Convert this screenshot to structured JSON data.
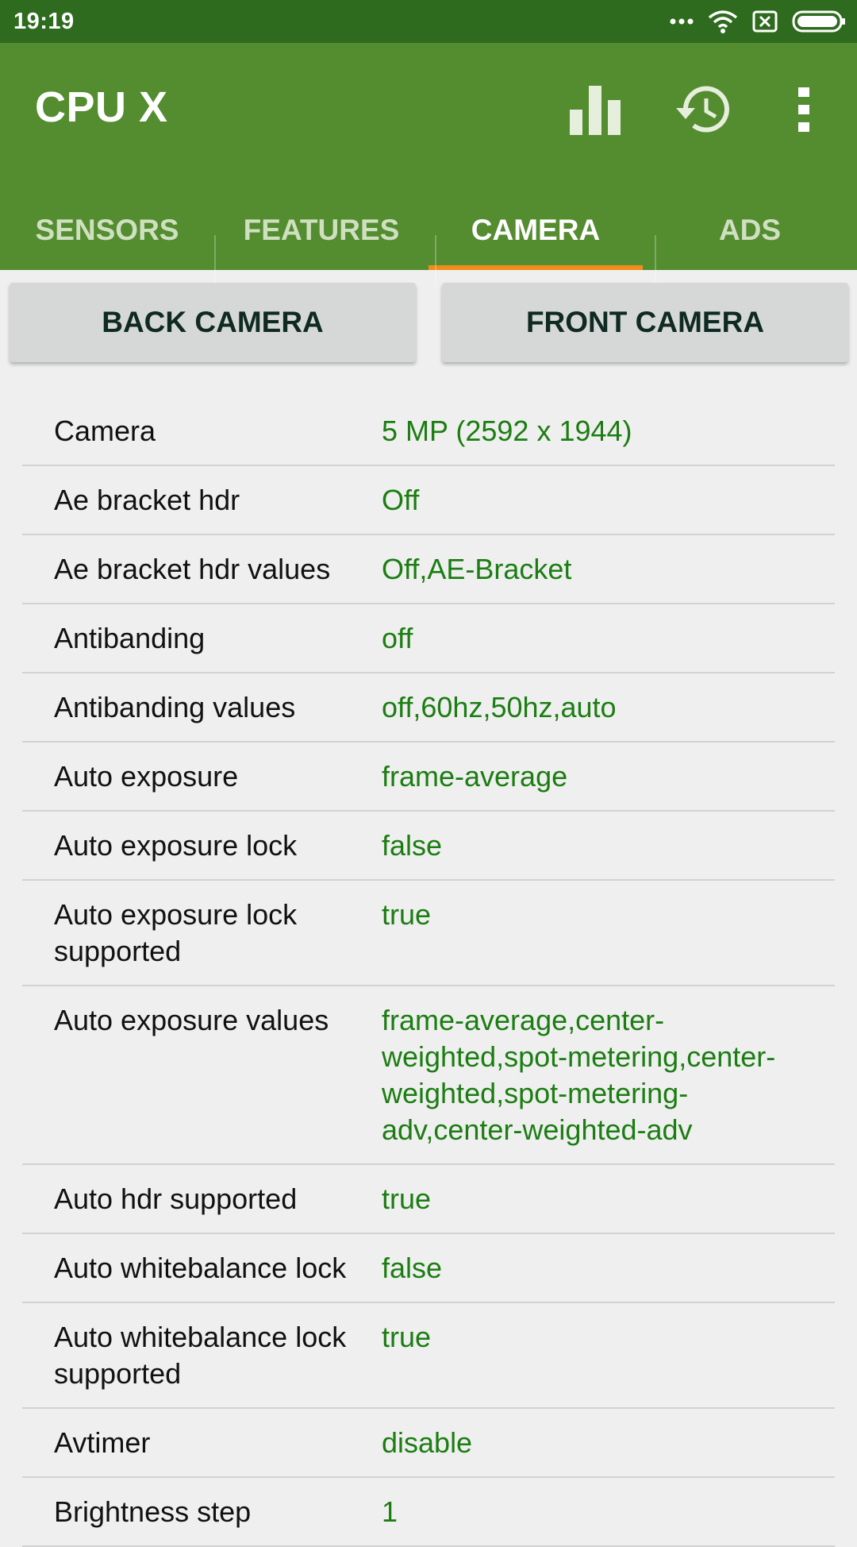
{
  "status_bar": {
    "time": "19:19",
    "icons": [
      "more-dots-icon",
      "wifi-icon",
      "sim-x-icon",
      "battery-icon"
    ]
  },
  "app_bar": {
    "title": "CPU X",
    "actions": [
      "bar-chart-icon",
      "history-icon",
      "more-vert-icon"
    ]
  },
  "colors": {
    "status_bar": "#2f6b1f",
    "app_bar": "#548c30",
    "tab_indicator": "#ef8d1b",
    "value_text": "#1b7d12",
    "background": "#efefef"
  },
  "tabs": [
    {
      "label": "SENSORS",
      "active": false
    },
    {
      "label": "FEATURES",
      "active": false
    },
    {
      "label": "CAMERA",
      "active": true
    },
    {
      "label": "ADS",
      "active": false
    }
  ],
  "buttons": {
    "back_camera": "BACK CAMERA",
    "front_camera": "FRONT CAMERA"
  },
  "rows": [
    {
      "label": "Camera",
      "value": "5 MP (2592 x 1944)"
    },
    {
      "label": "Ae bracket hdr",
      "value": "Off"
    },
    {
      "label": "Ae bracket hdr values",
      "value": "Off,AE-Bracket"
    },
    {
      "label": "Antibanding",
      "value": "off"
    },
    {
      "label": "Antibanding values",
      "value": "off,60hz,50hz,auto"
    },
    {
      "label": "Auto exposure",
      "value": "frame-average"
    },
    {
      "label": "Auto exposure lock",
      "value": "false"
    },
    {
      "label": "Auto exposure lock supported",
      "value": "true"
    },
    {
      "label": "Auto exposure values",
      "value": "frame-average,center-weighted,spot-metering,center-weighted,spot-metering-adv,center-weighted-adv"
    },
    {
      "label": "Auto hdr supported",
      "value": "true"
    },
    {
      "label": "Auto whitebalance lock",
      "value": "false"
    },
    {
      "label": "Auto whitebalance lock supported",
      "value": "true"
    },
    {
      "label": "Avtimer",
      "value": "disable"
    },
    {
      "label": "Brightness step",
      "value": "1"
    }
  ]
}
